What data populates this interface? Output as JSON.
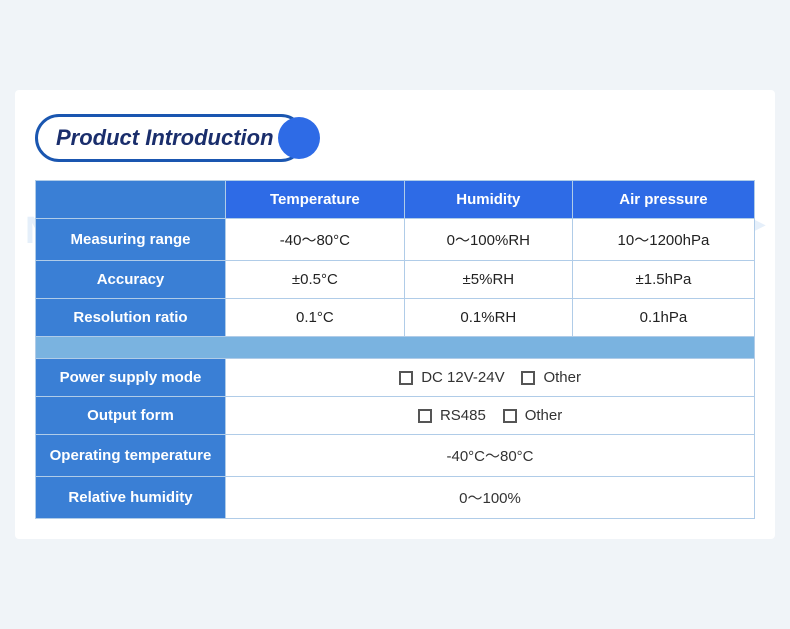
{
  "title": "Product Introduction",
  "watermark": "NiuBoL",
  "table": {
    "headers": {
      "col1": "",
      "col2": "Temperature",
      "col3": "Humidity",
      "col4": "Air pressure"
    },
    "rows": [
      {
        "label": "Measuring range",
        "col2": "-40～80°C",
        "col3": "0～100%RH",
        "col4": "10～1200hPa"
      },
      {
        "label": "Accuracy",
        "col2": "±0.5°C",
        "col3": "±5%RH",
        "col4": "±1.5hPa"
      },
      {
        "label": "Resolution ratio",
        "col2": "0.1°C",
        "col3": "0.1%RH",
        "col4": "0.1hPa"
      }
    ],
    "info_rows": [
      {
        "label": "Power supply mode",
        "value": "DC 12V-24V",
        "extra": "Other"
      },
      {
        "label": "Output form",
        "value": "RS485",
        "extra": "Other"
      },
      {
        "label": "Operating temperature",
        "value": "-40°C～80°C",
        "extra": ""
      },
      {
        "label": "Relative humidity",
        "value": "0～100%",
        "extra": ""
      }
    ]
  }
}
